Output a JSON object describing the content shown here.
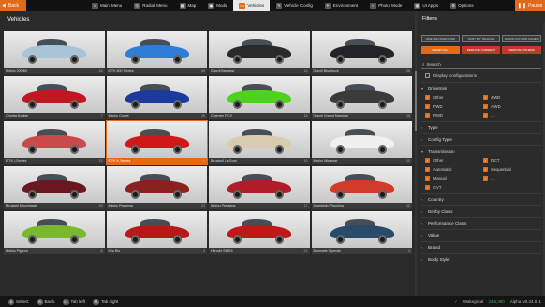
{
  "topbar": {
    "back_label": "Back",
    "pause_label": "Pause",
    "items": [
      {
        "label": "Main Menu",
        "icon": "home-icon",
        "glyph": "⌂"
      },
      {
        "label": "Radial Menu",
        "icon": "radial-icon",
        "glyph": "◎"
      },
      {
        "label": "Map",
        "icon": "map-icon",
        "glyph": "▦"
      },
      {
        "label": "Mods",
        "icon": "mods-icon",
        "glyph": "▣"
      },
      {
        "label": "Vehicles",
        "icon": "car-icon",
        "glyph": "▭",
        "active": true
      },
      {
        "label": "Vehicle Config",
        "icon": "wrench-icon",
        "glyph": "✎"
      },
      {
        "label": "Environment",
        "icon": "sun-icon",
        "glyph": "☀"
      },
      {
        "label": "Photo Mode",
        "icon": "camera-icon",
        "glyph": "▪"
      },
      {
        "label": "UI Apps",
        "icon": "apps-icon",
        "glyph": "▦"
      },
      {
        "label": "Options",
        "icon": "gear-icon",
        "glyph": "⚙"
      }
    ]
  },
  "vehicles": {
    "title": "Vehicles",
    "tiles": [
      {
        "name": "Ibishu 200BX",
        "count": "16",
        "color": "#a8c4d6"
      },
      {
        "name": "ETK 800 Series",
        "count": "55",
        "color": "#2f7dd6"
      },
      {
        "name": "Gavril Barstow",
        "count": "10",
        "color": "#2a2a2a"
      },
      {
        "name": "Gavril Bluebuck",
        "count": "26",
        "color": "#222426"
      },
      {
        "name": "Civetta Bolide",
        "count": "7",
        "color": "#c01820"
      },
      {
        "name": "Ibishu Covet",
        "count": "35",
        "color": "#1c3a9c"
      },
      {
        "name": "Cherrier FCV",
        "count": "18",
        "color": "#4fd21e"
      },
      {
        "name": "Gavril Grand Marshal",
        "count": "18",
        "color": "#3a3a3a"
      },
      {
        "name": "ETK I-Series",
        "count": "13",
        "color": "#c84a4a"
      },
      {
        "name": "ETK K-Series",
        "count": "20",
        "color": "#d01818",
        "selected": true
      },
      {
        "name": "Bruckell LeGran",
        "count": "19",
        "color": "#d8ccb0"
      },
      {
        "name": "Ibishu Miramar",
        "count": "10",
        "color": "#f0f0f0"
      },
      {
        "name": "Bruckell Moonhawk",
        "count": "19",
        "color": "#6a1820"
      },
      {
        "name": "Ibishu Pessima",
        "count": "23",
        "color": "#8a2020"
      },
      {
        "name": "Ibishu Pessima",
        "count": "17",
        "color": "#b01c28"
      },
      {
        "name": "Autobello Piccolina",
        "count": "12",
        "color": "#d23a2a"
      },
      {
        "name": "Ibishu Pigeon",
        "count": "8",
        "color": "#7ab830"
      },
      {
        "name": "Kia Rio",
        "count": "2",
        "color": "#b81818"
      },
      {
        "name": "Hirochi SBR4",
        "count": "21",
        "color": "#c01818"
      },
      {
        "name": "Burnside Special",
        "count": "4",
        "color": "#2a4a6a"
      }
    ]
  },
  "filters": {
    "title": "Filters",
    "buttons_top": [
      "HIDE BACKGROUND",
      "SORT BY VEHICLE",
      "SHOW AUTHOR NAMES"
    ],
    "buttons_bottom": [
      "RESET ALL",
      "REMOVE CURRENT",
      "REMOVE OTHERS"
    ],
    "search_placeholder": "Search",
    "display_config_label": "Display configurations",
    "sections": [
      {
        "label": "Drivetrain",
        "expanded": true,
        "options": [
          {
            "label": "Other",
            "checked": true
          },
          {
            "label": "4WD",
            "checked": true
          },
          {
            "label": "FWD",
            "checked": true
          },
          {
            "label": "AWD",
            "checked": true
          },
          {
            "label": "RWD",
            "checked": true
          },
          {
            "label": "...",
            "checked": true
          }
        ]
      },
      {
        "label": "Type",
        "expanded": false
      },
      {
        "label": "Config Type",
        "expanded": false
      },
      {
        "label": "Transmission",
        "expanded": true,
        "options": [
          {
            "label": "Other",
            "checked": true
          },
          {
            "label": "DCT",
            "checked": true
          },
          {
            "label": "Automatic",
            "checked": true
          },
          {
            "label": "Sequential",
            "checked": true
          },
          {
            "label": "Manual",
            "checked": true
          },
          {
            "label": "...",
            "checked": true
          },
          {
            "label": "CVT",
            "checked": true
          }
        ]
      },
      {
        "label": "Country",
        "expanded": false
      },
      {
        "label": "Derby Class",
        "expanded": false
      },
      {
        "label": "Performance Class",
        "expanded": false
      },
      {
        "label": "Value",
        "expanded": false
      },
      {
        "label": "Brand",
        "expanded": false
      },
      {
        "label": "Body Style",
        "expanded": false
      }
    ]
  },
  "bottombar": {
    "hints": [
      {
        "key": "A",
        "label": "Select"
      },
      {
        "key": "B",
        "label": "Back"
      },
      {
        "key": "L",
        "label": "Tab left"
      },
      {
        "key": "R",
        "label": "Tab right"
      }
    ],
    "status_prefix": "Wakegical",
    "status_value": "246,390",
    "version": "Alpha v0.24.0.1"
  }
}
